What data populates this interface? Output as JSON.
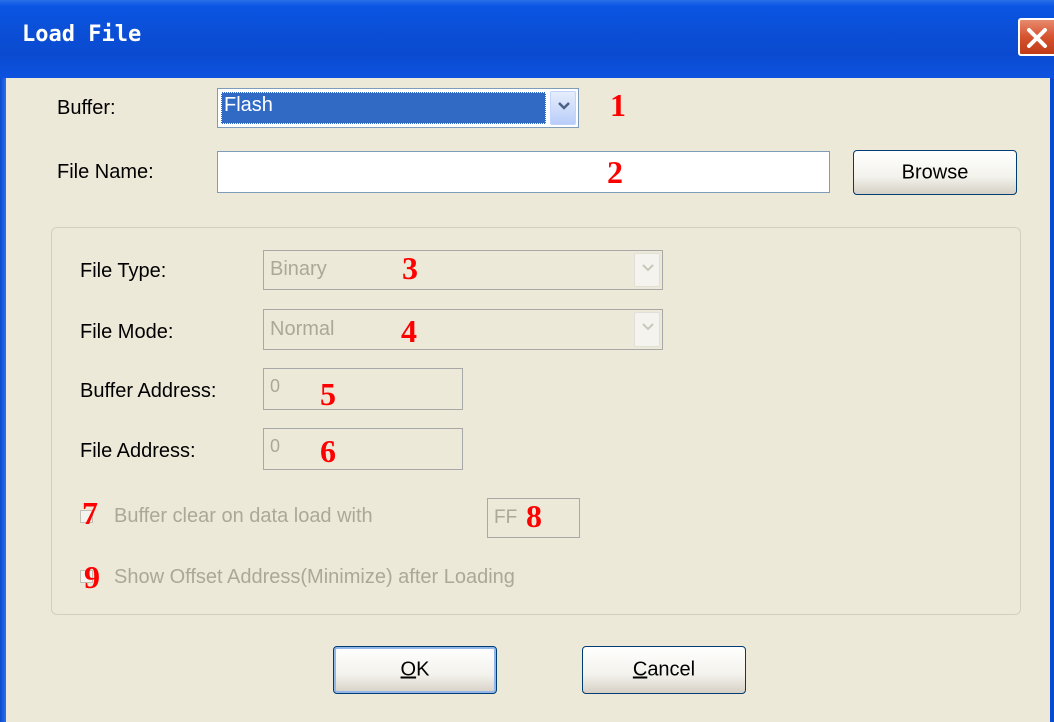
{
  "window": {
    "title": "Load File"
  },
  "buffer": {
    "label": "Buffer:",
    "value": "Flash",
    "marker": "1"
  },
  "file_name": {
    "label": "File Name:",
    "value": "",
    "marker": "2",
    "browse_label": "Browse"
  },
  "file_type": {
    "label": "File Type:",
    "value": "Binary",
    "marker": "3"
  },
  "file_mode": {
    "label": "File Mode:",
    "value": "Normal",
    "marker": "4"
  },
  "buffer_address": {
    "label": "Buffer Address:",
    "value": "0",
    "marker": "5"
  },
  "file_address": {
    "label": "File Address:",
    "value": "0",
    "marker": "6"
  },
  "buffer_clear": {
    "label": "Buffer clear on data load with",
    "marker": "7",
    "fill_value": "FF",
    "fill_marker": "8",
    "checked": false
  },
  "show_offset": {
    "label": "Show Offset Address(Minimize) after Loading",
    "marker": "9",
    "checked": false
  },
  "buttons": {
    "ok_mnemonic": "O",
    "ok_rest": "K",
    "cancel_mnemonic": "C",
    "cancel_rest": "ancel"
  },
  "colors": {
    "titlebar": "#0a55e3",
    "selection": "#316ac5",
    "marker": "#ff0000",
    "dialog_bg": "#ECE9D8"
  }
}
